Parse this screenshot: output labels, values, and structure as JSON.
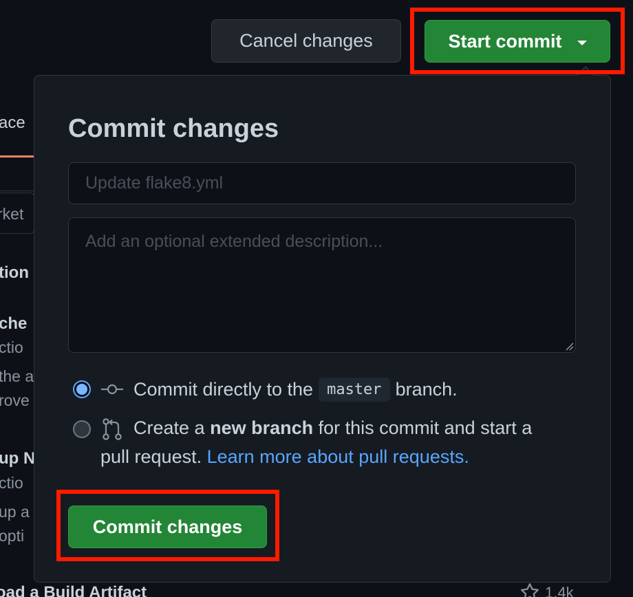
{
  "header": {
    "cancel_label": "Cancel changes",
    "start_commit_label": "Start commit"
  },
  "commit_dialog": {
    "title": "Commit changes",
    "summary_placeholder": "Update flake8.yml",
    "description_placeholder": "Add an optional extended description...",
    "option_direct": {
      "prefix": "Commit directly to the",
      "branch": "master",
      "suffix": "branch.",
      "selected": true
    },
    "option_new_branch": {
      "prefix": "Create a",
      "bold": "new branch",
      "suffix": "for this commit and start a",
      "line2": "pull request.",
      "link": "Learn more about pull requests.",
      "selected": false
    },
    "commit_button_label": "Commit changes"
  },
  "background": {
    "fragments": [
      "ace",
      "rket",
      "tion",
      "che",
      "ctio",
      "the a",
      "rove",
      "up N",
      "ctio",
      "up a",
      "opti"
    ],
    "bottom_item": "oad a Build Artifact",
    "bottom_star_count": "1.4k"
  },
  "colors": {
    "accent_green": "#238636",
    "link_blue": "#58a6ff",
    "highlight_red": "#ff1a00",
    "panel_bg": "#161b22",
    "page_bg": "#0d1117"
  }
}
